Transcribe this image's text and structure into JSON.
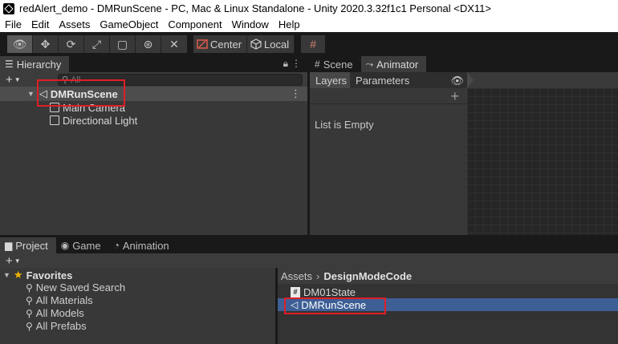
{
  "window": {
    "title": "redAlert_demo - DMRunScene - PC, Mac & Linux Standalone - Unity 2020.3.32f1c1 Personal <DX11>"
  },
  "menu": [
    "File",
    "Edit",
    "Assets",
    "GameObject",
    "Component",
    "Window",
    "Help"
  ],
  "toolbar": {
    "tools": [
      "eye-icon",
      "move-icon",
      "rotate-icon",
      "scale-icon",
      "rect-icon",
      "transform-icon",
      "custom-tool-icon"
    ],
    "pivot_label": "Center",
    "space_label": "Local"
  },
  "hierarchy": {
    "tab_label": "Hierarchy",
    "search_placeholder": "All",
    "scene_name": "DMRunScene",
    "items": [
      "Main Camera",
      "Directional Light"
    ]
  },
  "scene_tab": {
    "label": "Scene"
  },
  "animator": {
    "tab_label": "Animator",
    "subtabs": [
      "Layers",
      "Parameters"
    ],
    "empty_text": "List is Empty"
  },
  "bottom_tabs": [
    "Project",
    "Game",
    "Animation"
  ],
  "project": {
    "favorites_label": "Favorites",
    "favorites": [
      "New Saved Search",
      "All Materials",
      "All Models",
      "All Prefabs"
    ],
    "breadcrumb_root": "Assets",
    "breadcrumb_folder": "DesignModeCode",
    "assets": [
      {
        "name": "DM01State",
        "icon": "csharp-script-icon"
      },
      {
        "name": "DMRunScene",
        "icon": "unity-scene-icon"
      }
    ]
  },
  "colors": {
    "highlight_box": "#e01e26",
    "selection": "#3e5f96",
    "star": "#f0b400"
  }
}
